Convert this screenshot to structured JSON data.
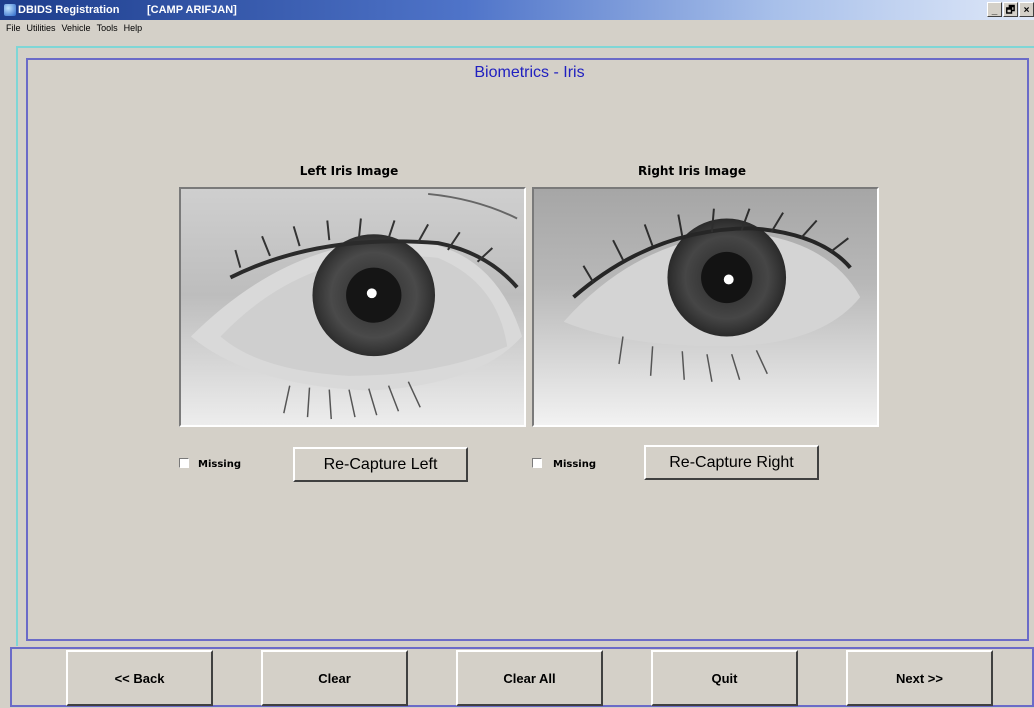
{
  "window": {
    "app_title": "DBIDS Registration",
    "site": "[CAMP ARIFJAN]",
    "controls": [
      "_",
      "🗗",
      "×"
    ]
  },
  "menu": [
    "File",
    "Utilities",
    "Vehicle",
    "Tools",
    "Help"
  ],
  "panel": {
    "title": "Biometrics - Iris",
    "left": {
      "label": "Left Iris Image",
      "missing_label": "Missing",
      "missing_checked": false,
      "recapture": "Re-Capture Left"
    },
    "right": {
      "label": "Right Iris Image",
      "missing_label": "Missing",
      "missing_checked": false,
      "recapture": "Re-Capture Right"
    }
  },
  "nav": {
    "back": "<< Back",
    "clear": "Clear",
    "clear_all": "Clear All",
    "quit": "Quit",
    "next": "Next >>"
  },
  "colors": {
    "title_text": "#2020c0",
    "panel_border": "#6b6bc8",
    "face": "#d4d0c8"
  }
}
